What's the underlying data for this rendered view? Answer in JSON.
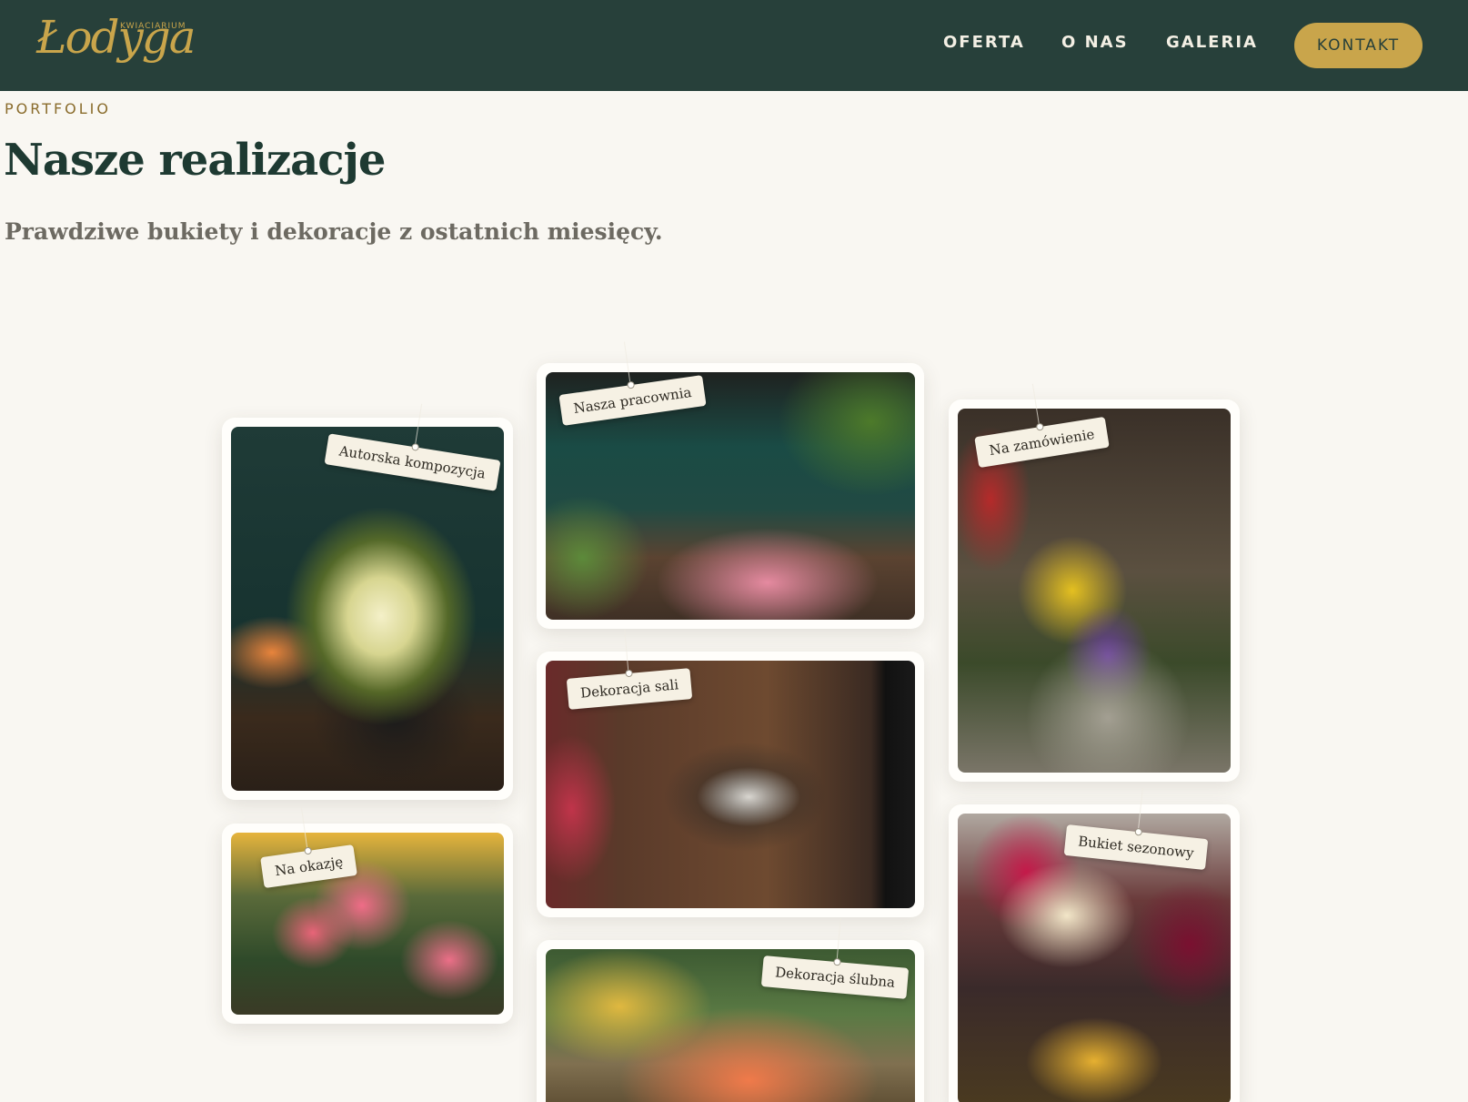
{
  "header": {
    "logo_small": "KWIACIARIUM",
    "logo_script": "Łodyga",
    "nav": [
      "OFERTA",
      "O NAS",
      "GALERIA"
    ],
    "cta": "KONTAKT"
  },
  "intro": {
    "eyebrow": "PORTFOLIO",
    "title": "Nasze realizacje",
    "subtitle": "Prawdziwe bukiety i dekoracje z ostatnich miesięcy."
  },
  "gallery": [
    {
      "tag": "Autorska kompozycja"
    },
    {
      "tag": "Na okazję"
    },
    {
      "tag": "Nasza pracownia"
    },
    {
      "tag": "Dekoracja sali"
    },
    {
      "tag": "Dekoracja ślubna"
    },
    {
      "tag": "Na zamówienie"
    },
    {
      "tag": "Bukiet sezonowy"
    }
  ],
  "colors": {
    "header_bg": "#27403a",
    "accent_gold": "#c9a54b",
    "page_bg": "#f9f7f2",
    "title": "#1e3a32"
  }
}
